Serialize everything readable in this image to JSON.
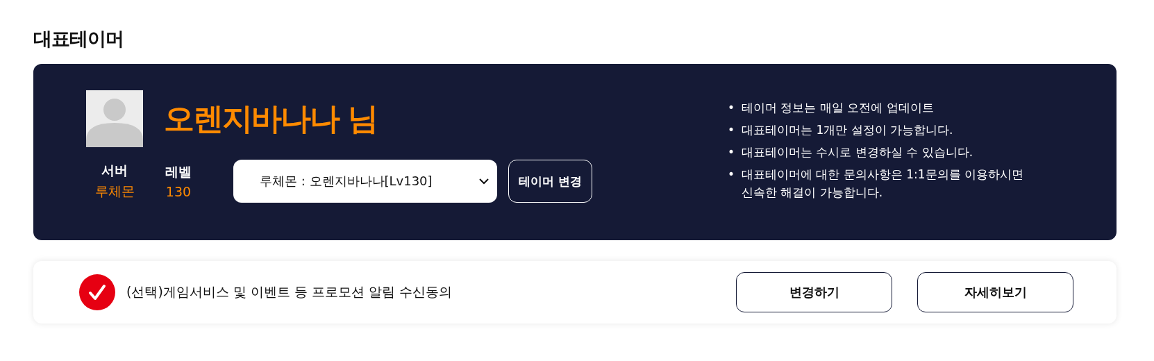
{
  "section_title": "대표테이머",
  "profile": {
    "name": "오렌지바나나 님",
    "server_label": "서버",
    "server": "루체몬",
    "level_label": "레벨",
    "level": "130"
  },
  "tamer_select": {
    "value": "루체몬 : 오렌지바나나[Lv130]"
  },
  "change_button": "테이머 변경",
  "notes": [
    {
      "bullet": "•",
      "text": "테이머 정보는 매일 오전에 업데이트"
    },
    {
      "bullet": "•",
      "text": "대표테이머는 1개만 설정이 가능합니다."
    },
    {
      "bullet": "•",
      "text": "대표테이머는 수시로 변경하실 수 있습니다."
    },
    {
      "bullet": "•",
      "text": "대표테이머에 대한 문의사항은 1:1문의를 이용하시면 신속한 해결이 가능합니다."
    }
  ],
  "consent": {
    "checked": true,
    "label": "(선택)게임서비스 및 이벤트 등 프로모션 알림 수신동의"
  },
  "consent_buttons": [
    "변경하기",
    "자세히보기"
  ]
}
